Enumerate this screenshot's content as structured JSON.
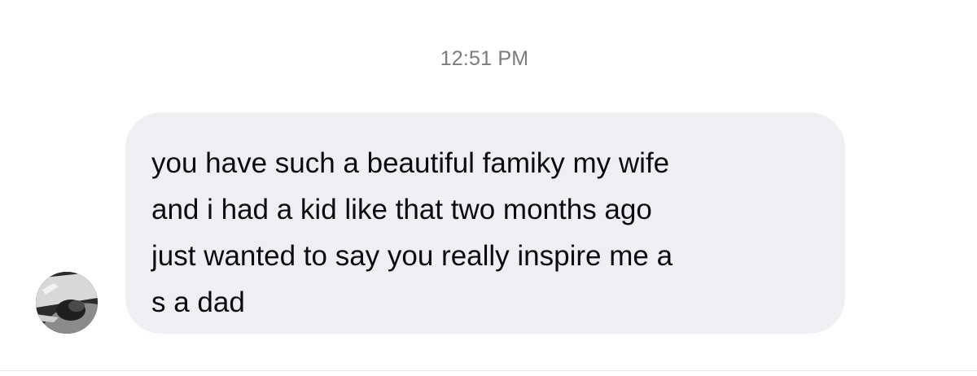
{
  "conversation": {
    "timestamp": "12:51 PM",
    "message": {
      "lines": [
        "you have such a beautiful famiky my wife",
        "and i had a kid like that two months ago",
        "just wanted to say you really inspire me a",
        "s a dad"
      ],
      "bubble_color": "#efeff3",
      "text_color": "#0c0c0c"
    },
    "sender": {
      "avatar_icon": "profile-photo-avatar"
    }
  }
}
